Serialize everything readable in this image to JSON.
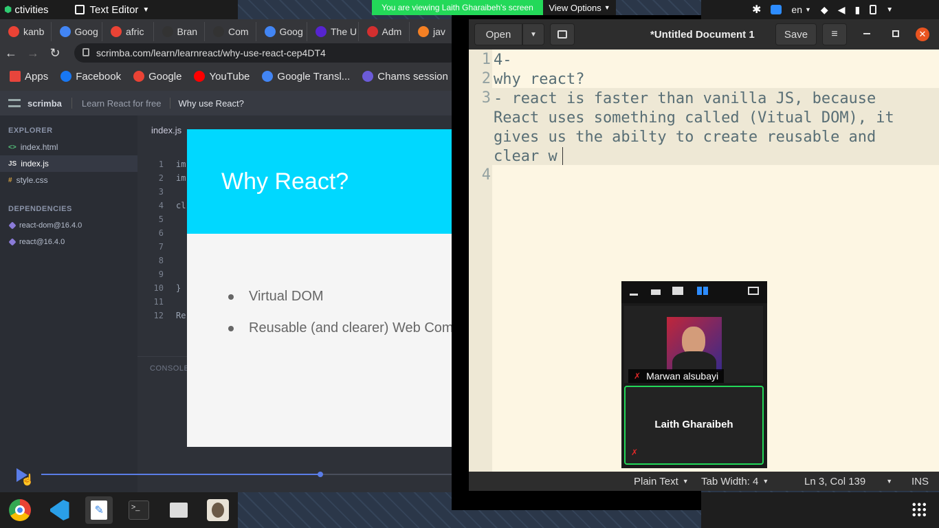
{
  "topbar": {
    "activities": "ctivities",
    "app_menu": "Text Editor",
    "lang": "en"
  },
  "share": {
    "banner": "You are viewing Laith Gharaibeh's screen",
    "view_options": "View Options"
  },
  "browser": {
    "tabs": [
      {
        "label": "kanb",
        "icon": "google-icon",
        "color": "#ea4335"
      },
      {
        "label": "Goog",
        "icon": "google-translate-icon",
        "color": "#4285f4"
      },
      {
        "label": "afric",
        "icon": "google-icon",
        "color": "#ea4335"
      },
      {
        "label": "Bran",
        "icon": "github-icon",
        "color": "#333"
      },
      {
        "label": "Com",
        "icon": "github-icon",
        "color": "#333"
      },
      {
        "label": "Goog",
        "icon": "google-translate-icon",
        "color": "#4285f4"
      },
      {
        "label": "The U",
        "icon": "udemy-icon",
        "color": "#5624d0"
      },
      {
        "label": "Adm",
        "icon": "admin-icon",
        "color": "#d32f2f"
      },
      {
        "label": "jav",
        "icon": "stackoverflow-icon",
        "color": "#f48024"
      }
    ],
    "url": "scrimba.com/learn/learnreact/why-use-react-cep4DT4",
    "bookmarks": [
      {
        "label": "Apps",
        "icon": "apps-grid-icon",
        "color": "#e8453c"
      },
      {
        "label": "Facebook",
        "icon": "facebook-icon",
        "color": "#1877f2"
      },
      {
        "label": "Google",
        "icon": "google-icon",
        "color": "#ea4335"
      },
      {
        "label": "YouTube",
        "icon": "youtube-icon",
        "color": "#ff0000"
      },
      {
        "label": "Google Transl...",
        "icon": "google-translate-icon",
        "color": "#4285f4"
      },
      {
        "label": "Chams session",
        "icon": "zoom-icon",
        "color": "#6b5bd8"
      }
    ]
  },
  "scrimba": {
    "logo": "scrimba",
    "crumb1": "Learn React for free",
    "crumb2": "Why use React?",
    "explorer": "EXPLORER",
    "files": [
      {
        "icon": "<>",
        "name": "index.html",
        "color": "#54c07a"
      },
      {
        "icon": "JS",
        "name": "index.js",
        "color": "#e0e0e0"
      },
      {
        "icon": "#",
        "name": "style.css",
        "color": "#d9a441"
      }
    ],
    "dependencies_title": "DEPENDENCIES",
    "deps": [
      "react-dom@16.4.0",
      "react@16.4.0"
    ],
    "editor_tab": "index.js",
    "line_numbers": [
      "1",
      "2",
      "3",
      "4",
      "5",
      "6",
      "7",
      "8",
      "9",
      "10",
      "11",
      "12"
    ],
    "code": [
      "im",
      "im",
      "",
      "cl",
      "",
      "",
      "",
      "",
      "",
      "}",
      "",
      "Re"
    ],
    "console": "CONSOLE",
    "slide_title": "Why React?",
    "bullets": [
      "Virtual DOM",
      "Reusable (and clearer) Web Com"
    ],
    "progress": 0.68
  },
  "gedit": {
    "open": "Open",
    "title": "*Untitled Document 1",
    "save": "Save",
    "lines": [
      {
        "num": "1",
        "text": "4-"
      },
      {
        "num": "2",
        "text": "why react?"
      },
      {
        "num": "3",
        "text": "- react is faster than vanilla JS, because\nReact uses something called (Vitual DOM), it\ngives us the abilty to create reusable and\nclear w"
      },
      {
        "num": "4",
        "text": ""
      }
    ],
    "status": {
      "lang": "Plain Text",
      "tab_width": "Tab Width: 4",
      "position": "Ln 3, Col 139",
      "mode": "INS"
    }
  },
  "zoom": {
    "participant1": "Marwan alsubayi",
    "participant2": "Laith Gharaibeh"
  }
}
